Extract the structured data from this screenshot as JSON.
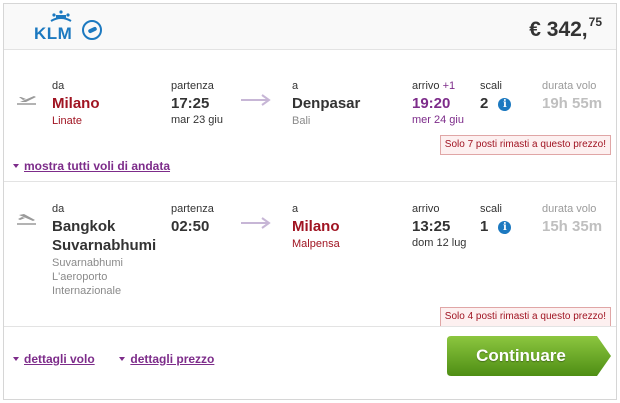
{
  "header": {
    "airline": "KLM",
    "price_main": "€ 342,",
    "price_cents": "75"
  },
  "outbound": {
    "from_label": "da",
    "from_city": "Milano",
    "from_airport": "Linate",
    "dep_label": "partenza",
    "dep_time": "17:25",
    "dep_date": "mar 23 giu",
    "to_label": "a",
    "to_city": "Denpasar",
    "to_airport": "Bali",
    "arr_label": "arrivo",
    "arr_plus": "+1",
    "arr_time": "19:20",
    "arr_date": "mer 24 giu",
    "stops_label": "scali",
    "stops": "2",
    "duration_label": "durata volo",
    "duration": "19h 55m",
    "seats_warning": "Solo 7 posti rimasti a questo prezzo!",
    "show_all_link": "mostra tutti voli di andata"
  },
  "return": {
    "from_label": "da",
    "from_city_line1": "Bangkok",
    "from_city_line2": "Suvarnabhumi",
    "from_airport_line1": "Suvarnabhumi",
    "from_airport_line2": "L'aeroporto",
    "from_airport_line3": "Internazionale",
    "dep_label": "partenza",
    "dep_time": "02:50",
    "to_label": "a",
    "to_city": "Milano",
    "to_airport": "Malpensa",
    "arr_label": "arrivo",
    "arr_time": "13:25",
    "arr_date": "dom 12 lug",
    "stops_label": "scali",
    "stops": "1",
    "duration_label": "durata volo",
    "duration": "15h 35m",
    "seats_warning": "Solo 4 posti rimasti a questo prezzo!"
  },
  "footer": {
    "flight_details_link": "dettagli volo",
    "price_details_link": "dettagli prezzo",
    "continue_button": "Continuare"
  },
  "colors": {
    "brand_blue": "#1c79c0",
    "city_red": "#a01422",
    "link_purple": "#7d2c8a",
    "button_green": "#6aaa1f"
  },
  "icons": {
    "logo": "klm-crown-logo",
    "alliance": "skyteam-icon",
    "takeoff": "plane-takeoff-icon",
    "landing": "plane-landing-icon",
    "arrow": "right-arrow-icon",
    "info": "info-icon"
  }
}
